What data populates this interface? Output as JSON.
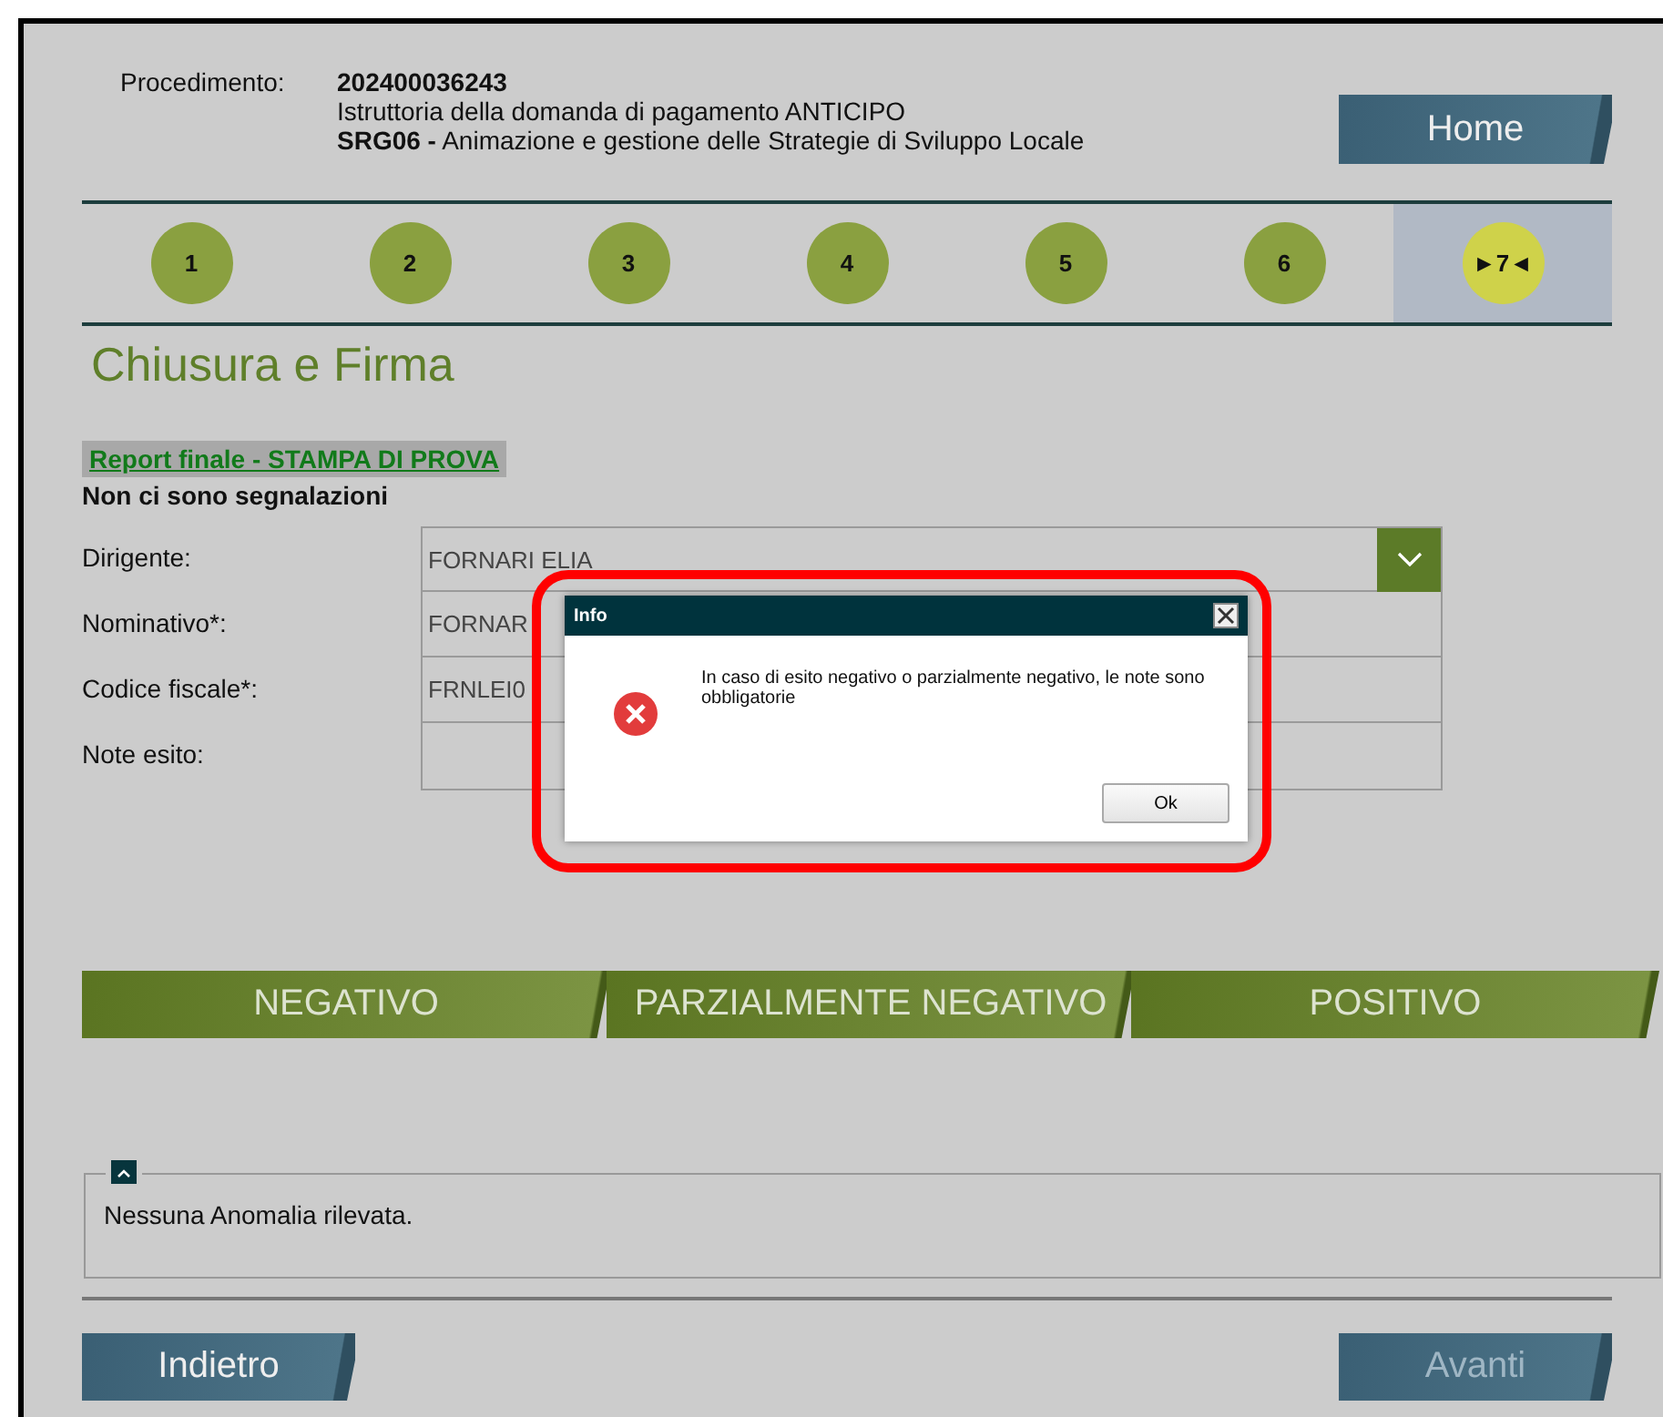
{
  "header": {
    "label": "Procedimento:",
    "number": "202400036243",
    "lines": [
      "Istruttoria della domanda di pagamento ANTICIPO",
      "**SRG06 -** Animazione e gestione delle Strategie di Sviluppo Locale"
    ],
    "home": "Home"
  },
  "steps": [
    {
      "label": "1",
      "selected": false
    },
    {
      "label": "2",
      "selected": false
    },
    {
      "label": "3",
      "selected": false
    },
    {
      "label": "4",
      "selected": false
    },
    {
      "label": "5",
      "selected": false
    },
    {
      "label": "6",
      "selected": false
    },
    {
      "label": "►7◄",
      "selected": true
    }
  ],
  "title": "Chiusura e Firma",
  "report_link": "Report finale - STAMPA DI PROVA",
  "notice": "Non ci sono segnalazioni",
  "fields": [
    {
      "label": "Dirigente:",
      "kind": "select",
      "value": "FORNARI ELIA"
    },
    {
      "label": "Nominativo*:",
      "kind": "text",
      "value": "FORNAR"
    },
    {
      "label": "Codice fiscale*:",
      "kind": "text",
      "value": "FRNLEI0"
    },
    {
      "label": "Note esito:",
      "kind": "textarea"
    }
  ],
  "outcome_buttons": [
    "NEGATIVO",
    "PARZIALMENTE NEGATIVO",
    "POSITIVO"
  ],
  "panel": {
    "expanded": true,
    "text": "Nessuna Anomalia rilevata."
  },
  "nav": [
    {
      "label": "Indietro",
      "disabled": false
    },
    {
      "label": "Avanti",
      "disabled": true
    }
  ],
  "dialog": {
    "title": "Info",
    "message": "In caso di esito negativo o parzialmente negativo, le note sono obbligatorie",
    "button": "Ok"
  }
}
